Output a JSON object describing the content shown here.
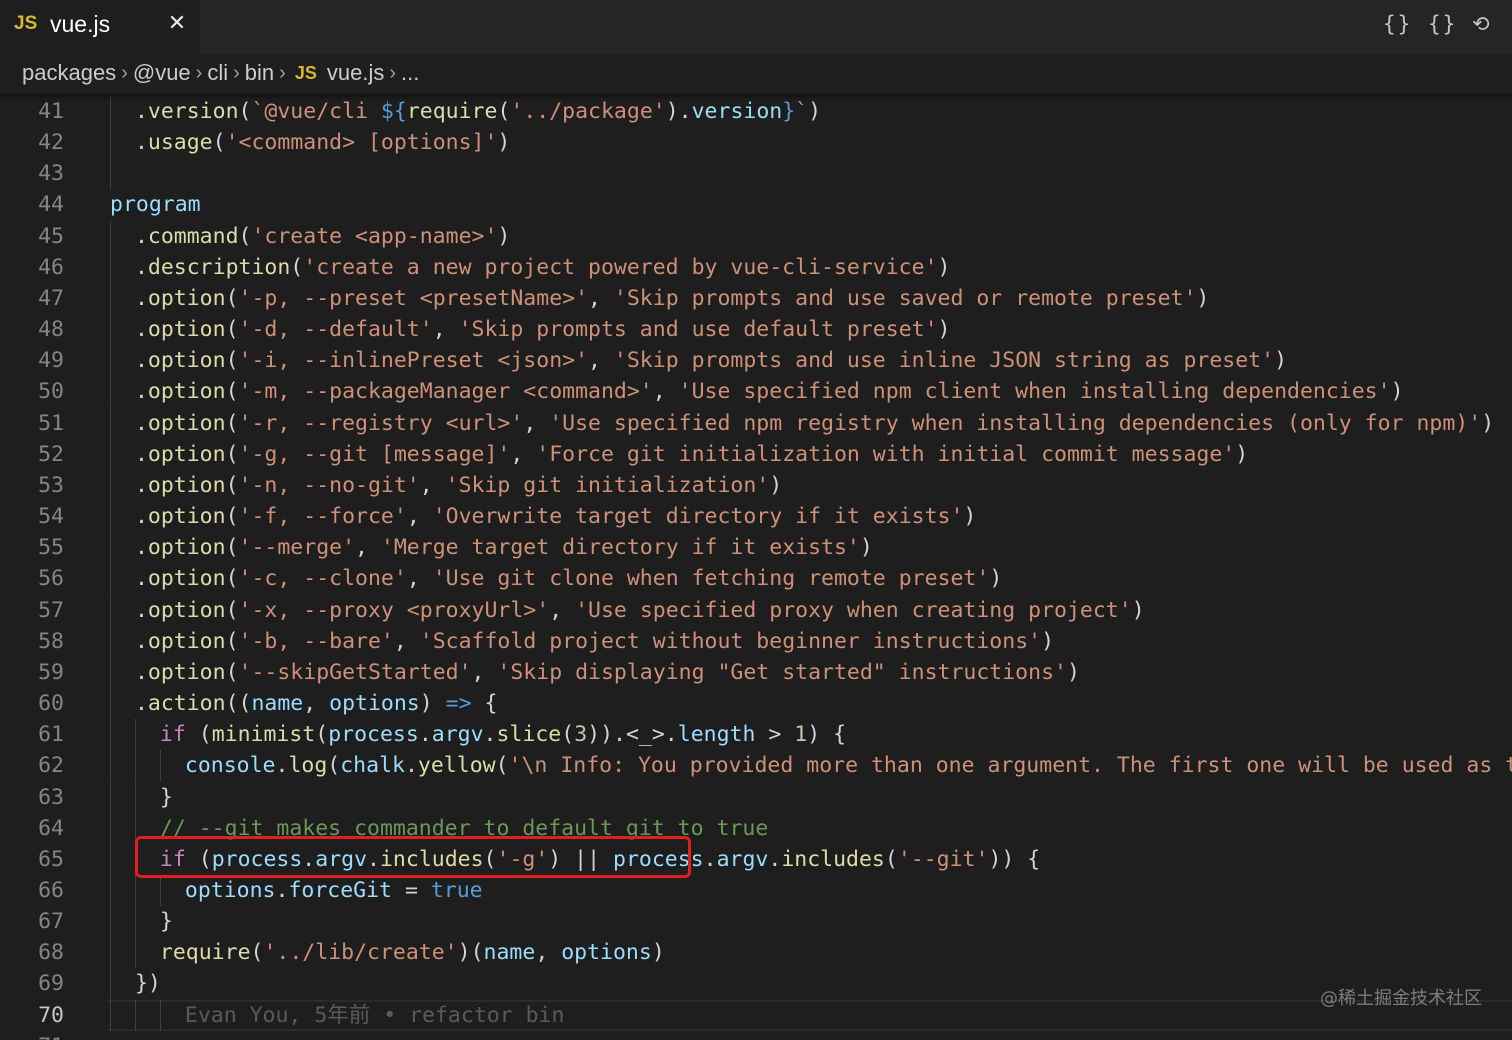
{
  "tab": {
    "lang_badge": "JS",
    "filename": "vue.js",
    "close_glyph": "✕"
  },
  "toolbar": {
    "icon1": "{}",
    "icon2": "{}",
    "icon3": "⟲"
  },
  "breadcrumb": {
    "items": [
      "packages",
      "@vue",
      "cli",
      "bin"
    ],
    "js_badge": "JS",
    "file": "vue.js",
    "ellipsis": "..."
  },
  "editor": {
    "active_line": 70,
    "lines": [
      {
        "n": "41",
        "indent": 1,
        "tokens": [
          [
            "t-plain",
            "."
          ],
          [
            "t-fn",
            "version"
          ],
          [
            "t-plain",
            "("
          ],
          [
            "t-str",
            "`@vue/cli "
          ],
          [
            "t-ph",
            "${"
          ],
          [
            "t-fn",
            "require"
          ],
          [
            "t-plain",
            "("
          ],
          [
            "t-str",
            "'../package'"
          ],
          [
            "t-plain",
            ")."
          ],
          [
            "t-var",
            "version"
          ],
          [
            "t-ph",
            "}"
          ],
          [
            "t-str",
            "`"
          ],
          [
            "t-plain",
            ")"
          ]
        ]
      },
      {
        "n": "42",
        "indent": 1,
        "tokens": [
          [
            "t-plain",
            "."
          ],
          [
            "t-fn",
            "usage"
          ],
          [
            "t-plain",
            "("
          ],
          [
            "t-str",
            "'<command> [options]'"
          ],
          [
            "t-plain",
            ")"
          ]
        ]
      },
      {
        "n": "43",
        "indent": 1,
        "tokens": []
      },
      {
        "n": "44",
        "indent": 0,
        "tokens": [
          [
            "t-var",
            "program"
          ]
        ]
      },
      {
        "n": "45",
        "indent": 1,
        "tokens": [
          [
            "t-plain",
            "."
          ],
          [
            "t-fn",
            "command"
          ],
          [
            "t-plain",
            "("
          ],
          [
            "t-str",
            "'create <app-name>'"
          ],
          [
            "t-plain",
            ")"
          ]
        ]
      },
      {
        "n": "46",
        "indent": 1,
        "tokens": [
          [
            "t-plain",
            "."
          ],
          [
            "t-fn",
            "description"
          ],
          [
            "t-plain",
            "("
          ],
          [
            "t-str",
            "'create a new project powered by vue-cli-service'"
          ],
          [
            "t-plain",
            ")"
          ]
        ]
      },
      {
        "n": "47",
        "indent": 1,
        "tokens": [
          [
            "t-plain",
            "."
          ],
          [
            "t-fn",
            "option"
          ],
          [
            "t-plain",
            "("
          ],
          [
            "t-str",
            "'-p, --preset <presetName>'"
          ],
          [
            "t-plain",
            ", "
          ],
          [
            "t-str",
            "'Skip prompts and use saved or remote preset'"
          ],
          [
            "t-plain",
            ")"
          ]
        ]
      },
      {
        "n": "48",
        "indent": 1,
        "tokens": [
          [
            "t-plain",
            "."
          ],
          [
            "t-fn",
            "option"
          ],
          [
            "t-plain",
            "("
          ],
          [
            "t-str",
            "'-d, --default'"
          ],
          [
            "t-plain",
            ", "
          ],
          [
            "t-str",
            "'Skip prompts and use default preset'"
          ],
          [
            "t-plain",
            ")"
          ]
        ]
      },
      {
        "n": "49",
        "indent": 1,
        "tokens": [
          [
            "t-plain",
            "."
          ],
          [
            "t-fn",
            "option"
          ],
          [
            "t-plain",
            "("
          ],
          [
            "t-str",
            "'-i, --inlinePreset <json>'"
          ],
          [
            "t-plain",
            ", "
          ],
          [
            "t-str",
            "'Skip prompts and use inline JSON string as preset'"
          ],
          [
            "t-plain",
            ")"
          ]
        ]
      },
      {
        "n": "50",
        "indent": 1,
        "tokens": [
          [
            "t-plain",
            "."
          ],
          [
            "t-fn",
            "option"
          ],
          [
            "t-plain",
            "("
          ],
          [
            "t-str",
            "'-m, --packageManager <command>'"
          ],
          [
            "t-plain",
            ", "
          ],
          [
            "t-str",
            "'Use specified npm client when installing dependencies'"
          ],
          [
            "t-plain",
            ")"
          ]
        ]
      },
      {
        "n": "51",
        "indent": 1,
        "tokens": [
          [
            "t-plain",
            "."
          ],
          [
            "t-fn",
            "option"
          ],
          [
            "t-plain",
            "("
          ],
          [
            "t-str",
            "'-r, --registry <url>'"
          ],
          [
            "t-plain",
            ", "
          ],
          [
            "t-str",
            "'Use specified npm registry when installing dependencies (only for npm)'"
          ],
          [
            "t-plain",
            ")"
          ]
        ]
      },
      {
        "n": "52",
        "indent": 1,
        "tokens": [
          [
            "t-plain",
            "."
          ],
          [
            "t-fn",
            "option"
          ],
          [
            "t-plain",
            "("
          ],
          [
            "t-str",
            "'-g, --git [message]'"
          ],
          [
            "t-plain",
            ", "
          ],
          [
            "t-str",
            "'Force git initialization with initial commit message'"
          ],
          [
            "t-plain",
            ")"
          ]
        ]
      },
      {
        "n": "53",
        "indent": 1,
        "tokens": [
          [
            "t-plain",
            "."
          ],
          [
            "t-fn",
            "option"
          ],
          [
            "t-plain",
            "("
          ],
          [
            "t-str",
            "'-n, --no-git'"
          ],
          [
            "t-plain",
            ", "
          ],
          [
            "t-str",
            "'Skip git initialization'"
          ],
          [
            "t-plain",
            ")"
          ]
        ]
      },
      {
        "n": "54",
        "indent": 1,
        "tokens": [
          [
            "t-plain",
            "."
          ],
          [
            "t-fn",
            "option"
          ],
          [
            "t-plain",
            "("
          ],
          [
            "t-str",
            "'-f, --force'"
          ],
          [
            "t-plain",
            ", "
          ],
          [
            "t-str",
            "'Overwrite target directory if it exists'"
          ],
          [
            "t-plain",
            ")"
          ]
        ]
      },
      {
        "n": "55",
        "indent": 1,
        "tokens": [
          [
            "t-plain",
            "."
          ],
          [
            "t-fn",
            "option"
          ],
          [
            "t-plain",
            "("
          ],
          [
            "t-str",
            "'--merge'"
          ],
          [
            "t-plain",
            ", "
          ],
          [
            "t-str",
            "'Merge target directory if it exists'"
          ],
          [
            "t-plain",
            ")"
          ]
        ]
      },
      {
        "n": "56",
        "indent": 1,
        "tokens": [
          [
            "t-plain",
            "."
          ],
          [
            "t-fn",
            "option"
          ],
          [
            "t-plain",
            "("
          ],
          [
            "t-str",
            "'-c, --clone'"
          ],
          [
            "t-plain",
            ", "
          ],
          [
            "t-str",
            "'Use git clone when fetching remote preset'"
          ],
          [
            "t-plain",
            ")"
          ]
        ]
      },
      {
        "n": "57",
        "indent": 1,
        "tokens": [
          [
            "t-plain",
            "."
          ],
          [
            "t-fn",
            "option"
          ],
          [
            "t-plain",
            "("
          ],
          [
            "t-str",
            "'-x, --proxy <proxyUrl>'"
          ],
          [
            "t-plain",
            ", "
          ],
          [
            "t-str",
            "'Use specified proxy when creating project'"
          ],
          [
            "t-plain",
            ")"
          ]
        ]
      },
      {
        "n": "58",
        "indent": 1,
        "tokens": [
          [
            "t-plain",
            "."
          ],
          [
            "t-fn",
            "option"
          ],
          [
            "t-plain",
            "("
          ],
          [
            "t-str",
            "'-b, --bare'"
          ],
          [
            "t-plain",
            ", "
          ],
          [
            "t-str",
            "'Scaffold project without beginner instructions'"
          ],
          [
            "t-plain",
            ")"
          ]
        ]
      },
      {
        "n": "59",
        "indent": 1,
        "tokens": [
          [
            "t-plain",
            "."
          ],
          [
            "t-fn",
            "option"
          ],
          [
            "t-plain",
            "("
          ],
          [
            "t-str",
            "'--skipGetStarted'"
          ],
          [
            "t-plain",
            ", "
          ],
          [
            "t-str",
            "'Skip displaying \"Get started\" instructions'"
          ],
          [
            "t-plain",
            ")"
          ]
        ]
      },
      {
        "n": "60",
        "indent": 1,
        "tokens": [
          [
            "t-plain",
            "."
          ],
          [
            "t-fn",
            "action"
          ],
          [
            "t-plain",
            "(("
          ],
          [
            "t-var",
            "name"
          ],
          [
            "t-plain",
            ", "
          ],
          [
            "t-var",
            "options"
          ],
          [
            "t-plain",
            ") "
          ],
          [
            "t-kw",
            "=>"
          ],
          [
            "t-plain",
            " {"
          ]
        ]
      },
      {
        "n": "61",
        "indent": 2,
        "tokens": [
          [
            "t-ctl",
            "if"
          ],
          [
            "t-plain",
            " ("
          ],
          [
            "t-fn",
            "minimist"
          ],
          [
            "t-plain",
            "("
          ],
          [
            "t-var",
            "process"
          ],
          [
            "t-plain",
            "."
          ],
          [
            "t-var",
            "argv"
          ],
          [
            "t-plain",
            "."
          ],
          [
            "t-fn",
            "slice"
          ],
          [
            "t-plain",
            "("
          ],
          [
            "t-num",
            "3"
          ],
          [
            "t-plain",
            ")).<_>."
          ],
          [
            "t-var",
            "length"
          ],
          [
            "t-plain",
            " > "
          ],
          [
            "t-num",
            "1"
          ],
          [
            "t-plain",
            ") {"
          ]
        ]
      },
      {
        "n": "62",
        "indent": 3,
        "tokens": [
          [
            "t-var",
            "console"
          ],
          [
            "t-plain",
            "."
          ],
          [
            "t-fn",
            "log"
          ],
          [
            "t-plain",
            "("
          ],
          [
            "t-var",
            "chalk"
          ],
          [
            "t-plain",
            "."
          ],
          [
            "t-fn",
            "yellow"
          ],
          [
            "t-plain",
            "("
          ],
          [
            "t-str",
            "'\\n Info: You provided more than one argument. The first one will be used as the app's name, the rest are ignored.'"
          ],
          [
            "t-plain",
            "))"
          ]
        ]
      },
      {
        "n": "63",
        "indent": 2,
        "tokens": [
          [
            "t-plain",
            "}"
          ]
        ]
      },
      {
        "n": "64",
        "indent": 2,
        "tokens": [
          [
            "t-cmt",
            "// --git makes commander to default git to true"
          ]
        ]
      },
      {
        "n": "65",
        "indent": 2,
        "tokens": [
          [
            "t-ctl",
            "if"
          ],
          [
            "t-plain",
            " ("
          ],
          [
            "t-var",
            "process"
          ],
          [
            "t-plain",
            "."
          ],
          [
            "t-var",
            "argv"
          ],
          [
            "t-plain",
            "."
          ],
          [
            "t-fn",
            "includes"
          ],
          [
            "t-plain",
            "("
          ],
          [
            "t-str",
            "'-g'"
          ],
          [
            "t-plain",
            ") || "
          ],
          [
            "t-var",
            "process"
          ],
          [
            "t-plain",
            "."
          ],
          [
            "t-var",
            "argv"
          ],
          [
            "t-plain",
            "."
          ],
          [
            "t-fn",
            "includes"
          ],
          [
            "t-plain",
            "("
          ],
          [
            "t-str",
            "'--git'"
          ],
          [
            "t-plain",
            ")) {"
          ]
        ]
      },
      {
        "n": "66",
        "indent": 3,
        "tokens": [
          [
            "t-var",
            "options"
          ],
          [
            "t-plain",
            "."
          ],
          [
            "t-var",
            "forceGit"
          ],
          [
            "t-plain",
            " = "
          ],
          [
            "t-kw",
            "true"
          ]
        ]
      },
      {
        "n": "67",
        "indent": 2,
        "tokens": [
          [
            "t-plain",
            "}"
          ]
        ]
      },
      {
        "n": "68",
        "indent": 2,
        "tokens": [
          [
            "t-fn",
            "require"
          ],
          [
            "t-plain",
            "("
          ],
          [
            "t-str",
            "'../lib/create'"
          ],
          [
            "t-plain",
            ")("
          ],
          [
            "t-var",
            "name"
          ],
          [
            "t-plain",
            ", "
          ],
          [
            "t-var",
            "options"
          ],
          [
            "t-plain",
            ")"
          ]
        ]
      },
      {
        "n": "69",
        "indent": 1,
        "tokens": [
          [
            "t-plain",
            "})"
          ]
        ]
      },
      {
        "n": "70",
        "indent": 3,
        "tokens": [
          [
            "t-blame",
            "Evan You, 5年前 • refactor bin"
          ]
        ]
      },
      {
        "n": "71",
        "indent": 0,
        "tokens": []
      }
    ]
  },
  "watermark": "@稀土掘金技术社区"
}
